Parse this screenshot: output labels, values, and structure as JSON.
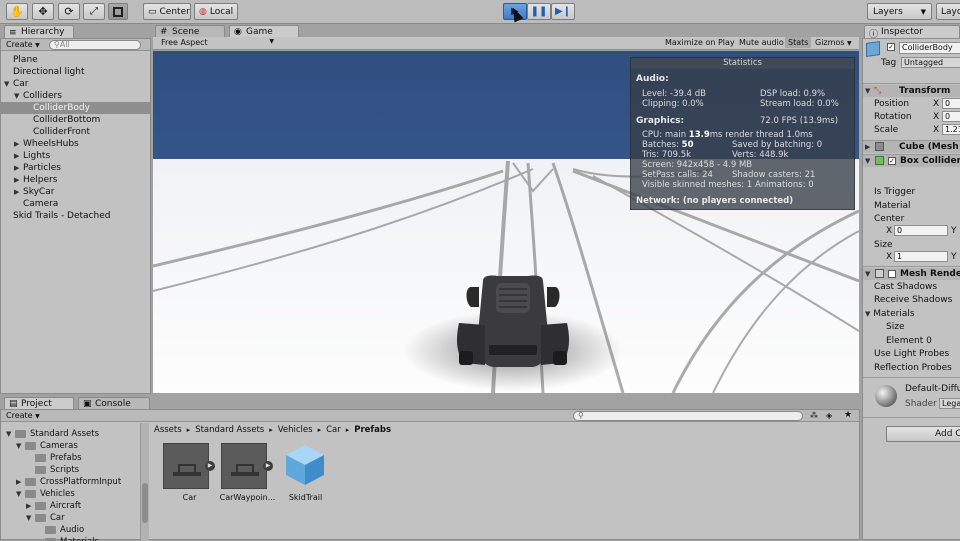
{
  "toolbar": {
    "pivot_label": "Center",
    "space_label": "Local",
    "layers_label": "Layers",
    "layout_label": "Layo"
  },
  "scene_tab": "Scene",
  "game_tab": "Game",
  "game_bar": {
    "aspect": "Free Aspect",
    "maximize": "Maximize on Play",
    "mute": "Mute audio",
    "stats": "Stats",
    "gizmos": "Gizmos"
  },
  "hierarchy": {
    "tab": "Hierarchy",
    "create": "Create",
    "search_placeholder": "All",
    "items": [
      {
        "label": "Plane",
        "depth": 0,
        "arrow": ""
      },
      {
        "label": "Directional light",
        "depth": 0,
        "arrow": ""
      },
      {
        "label": "Car",
        "depth": 0,
        "arrow": "▼"
      },
      {
        "label": "Colliders",
        "depth": 1,
        "arrow": "▼"
      },
      {
        "label": "ColliderBody",
        "depth": 2,
        "arrow": "",
        "selected": true
      },
      {
        "label": "ColliderBottom",
        "depth": 2,
        "arrow": ""
      },
      {
        "label": "ColliderFront",
        "depth": 2,
        "arrow": ""
      },
      {
        "label": "WheelsHubs",
        "depth": 1,
        "arrow": "▶"
      },
      {
        "label": "Lights",
        "depth": 1,
        "arrow": "▶"
      },
      {
        "label": "Particles",
        "depth": 1,
        "arrow": "▶"
      },
      {
        "label": "Helpers",
        "depth": 1,
        "arrow": "▶"
      },
      {
        "label": "SkyCar",
        "depth": 1,
        "arrow": "▶"
      },
      {
        "label": "Camera",
        "depth": 1,
        "arrow": ""
      },
      {
        "label": "Skid Trails - Detached",
        "depth": 0,
        "arrow": ""
      }
    ]
  },
  "stats": {
    "title": "Statistics",
    "audio_header": "Audio:",
    "level": "Level: -39.4 dB",
    "clipping": "Clipping: 0.0%",
    "dsp": "DSP load: 0.9%",
    "stream": "Stream load: 0.0%",
    "graphics_header": "Graphics:",
    "fps": "72.0 FPS (13.9ms)",
    "cpu_prefix": "CPU: main ",
    "cpu_value": "13.9",
    "cpu_suffix": "ms  render thread 1.0ms",
    "batches_prefix": "Batches: ",
    "batches_value": "50",
    "saved": "Saved by batching: 0",
    "tris": "Tris: 709.5k",
    "verts": "Verts: 448.9k",
    "screen": "Screen: 942x458 - 4.9 MB",
    "setpass": "SetPass calls: 24",
    "shadow": "Shadow casters: 21",
    "skinned": "Visible skinned meshes: 1  Animations: 0",
    "network": "Network: (no players connected)"
  },
  "project": {
    "tab": "Project",
    "console_tab": "Console",
    "create": "Create",
    "tree": [
      {
        "label": "Standard Assets",
        "depth": 0,
        "arrow": "▼"
      },
      {
        "label": "Cameras",
        "depth": 1,
        "arrow": "▼"
      },
      {
        "label": "Prefabs",
        "depth": 2,
        "arrow": ""
      },
      {
        "label": "Scripts",
        "depth": 2,
        "arrow": ""
      },
      {
        "label": "CrossPlatformInput",
        "depth": 1,
        "arrow": "▶"
      },
      {
        "label": "Vehicles",
        "depth": 1,
        "arrow": "▼"
      },
      {
        "label": "Aircraft",
        "depth": 2,
        "arrow": "▶"
      },
      {
        "label": "Car",
        "depth": 2,
        "arrow": "▼"
      },
      {
        "label": "Audio",
        "depth": 3,
        "arrow": ""
      },
      {
        "label": "Materials",
        "depth": 3,
        "arrow": ""
      }
    ],
    "breadcrumb": [
      "Assets",
      "Standard Assets",
      "Vehicles",
      "Car",
      "Prefabs"
    ],
    "assets": [
      {
        "label": "Car",
        "kind": "prefab"
      },
      {
        "label": "CarWaypoin...",
        "kind": "prefab"
      },
      {
        "label": "SkidTrail",
        "kind": "cube"
      }
    ]
  },
  "inspector": {
    "tab": "Inspector",
    "object_name": "ColliderBody",
    "tag_label": "Tag",
    "tag_value": "Untagged",
    "transform_title": "Transform",
    "position_label": "Position",
    "rotation_label": "Rotation",
    "scale_label": "Scale",
    "x_label": "X",
    "y_label": "Y",
    "position_x": "0",
    "rotation_x": "0",
    "scale_x": "1.21",
    "mesh_filter_title": "Cube (Mesh F",
    "box_collider_title": "Box Collider",
    "is_trigger": "Is Trigger",
    "material": "Material",
    "center_label": "Center",
    "center_x": "0",
    "size_label": "Size",
    "size_x": "1",
    "mesh_renderer_title": "Mesh Render",
    "cast_shadows": "Cast Shadows",
    "receive_shadows": "Receive Shadows",
    "materials_label": "Materials",
    "size_sub": "Size",
    "element0": "Element 0",
    "use_light_probes": "Use Light Probes",
    "reflection_probes": "Reflection Probes",
    "material_name": "Default-Diffu",
    "shader_label": "Shader",
    "shader_value": "Lega",
    "add_component": "Add C"
  }
}
